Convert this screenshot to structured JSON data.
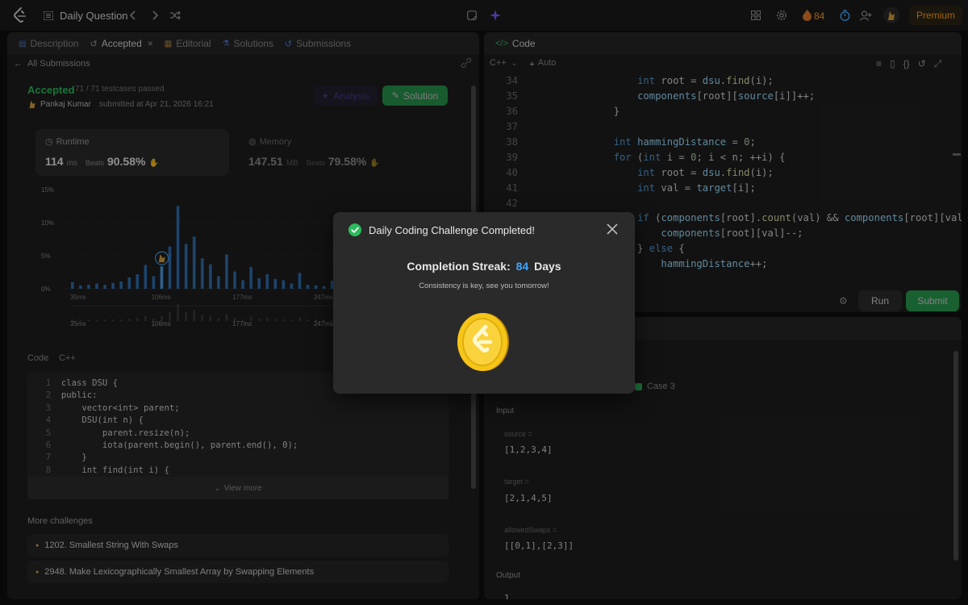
{
  "topbar": {
    "title": "Daily Question",
    "streak_count": "84",
    "premium_label": "Premium"
  },
  "left_tabs": [
    {
      "label": "Description"
    },
    {
      "label": "Accepted"
    },
    {
      "label": "Editorial"
    },
    {
      "label": "Solutions"
    },
    {
      "label": "Submissions"
    }
  ],
  "submission": {
    "back_label": "All Submissions",
    "status": "Accepted",
    "testcases": "71 / 71 testcases passed",
    "user": "Pankaj Kumar",
    "submitted_text": "submitted at Apr 21, 2026 16:21",
    "analysis_label": "Analysis",
    "solution_label": "Solution",
    "runtime_label": "Runtime",
    "runtime_value": "114",
    "runtime_unit": "ms",
    "beats_label": "Beats",
    "runtime_beats": "90.58%",
    "memory_label": "Memory",
    "memory_value": "147.51",
    "memory_unit": "MB",
    "memory_beats": "79.58%"
  },
  "chart_data": {
    "type": "bar",
    "yticks": [
      "15%",
      "10%",
      "5%",
      "0%"
    ],
    "xticks": [
      "35ms",
      "106ms",
      "177ms",
      "247ms"
    ],
    "mini_xticks": [
      "35ms",
      "106ms",
      "177ms",
      "247ms"
    ],
    "ylim": [
      0,
      15
    ],
    "values": [
      1,
      0.5,
      0.6,
      0.8,
      0.6,
      0.9,
      1.1,
      1.7,
      2.2,
      3.6,
      1.9,
      3.4,
      6.4,
      12.5,
      6.8,
      7.9,
      4.6,
      3.7,
      1.9,
      5.2,
      2.6,
      1.3,
      3.3,
      1.6,
      2.2,
      1.5,
      1.3,
      0.8,
      2.4,
      0.6,
      0.5,
      0.4,
      1.2
    ],
    "highlight_index": 11
  },
  "left_code": {
    "label": "Code",
    "lang": "C++",
    "lines": [
      {
        "n": "1",
        "t": "class DSU {"
      },
      {
        "n": "2",
        "t": "public:"
      },
      {
        "n": "3",
        "t": "    vector<int> parent;"
      },
      {
        "n": "4",
        "t": "    DSU(int n) {"
      },
      {
        "n": "5",
        "t": "        parent.resize(n);"
      },
      {
        "n": "6",
        "t": "        iota(parent.begin(), parent.end(), 0);"
      },
      {
        "n": "7",
        "t": "    }"
      },
      {
        "n": "8",
        "t": "    int find(int i) {"
      }
    ],
    "view_more": "View more"
  },
  "more_challenges": {
    "title": "More challenges",
    "items": [
      "1202. Smallest String With Swaps",
      "2948. Make Lexicographically Smallest Array by Swapping Elements"
    ]
  },
  "editor": {
    "tab_label": "Code",
    "lang": "C++",
    "mode": "Auto",
    "run_label": "Run",
    "submit_label": "Submit"
  },
  "testcase": {
    "case_label": "Case 3",
    "input_label": "Input",
    "output_label": "Output",
    "output_value": "1",
    "params": [
      {
        "name": "source =",
        "value": "[1,2,3,4]"
      },
      {
        "name": "target =",
        "value": "[2,1,4,5]"
      },
      {
        "name": "allowedSwaps =",
        "value": "[[0,1],[2,3]]"
      }
    ]
  },
  "modal": {
    "title": "Daily Coding Challenge Completed!",
    "streak_label": "Completion Streak:",
    "streak_value": "84",
    "streak_unit": "Days",
    "message": "Consistency is key, see you tomorrow!"
  },
  "colors": {
    "accent_green": "#2cbb5d",
    "streak_blue": "#3ea6ff",
    "orange": "#ffa116",
    "chart_blue": "#3b82c4"
  }
}
